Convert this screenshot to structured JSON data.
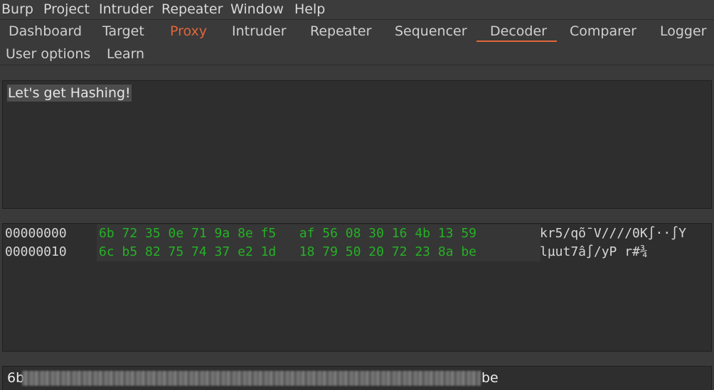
{
  "menu": [
    "Burp",
    "Project",
    "Intruder",
    "Repeater",
    "Window",
    "Help"
  ],
  "tabs": [
    "Dashboard",
    "Target",
    "Proxy",
    "Intruder",
    "Repeater",
    "Sequencer",
    "Decoder",
    "Comparer",
    "Logger",
    "User options",
    "Learn"
  ],
  "active_tab": "Decoder",
  "highlighted_tab": "Proxy",
  "colors": {
    "accent": "#e0663a",
    "hex_bytes": "#25b125",
    "background": "#3a3a3a",
    "panel": "#2e2e2e"
  },
  "input": {
    "text": "Let's get Hashing!"
  },
  "hex_view": {
    "rows": [
      {
        "offset": "00000000",
        "bytes": "6b 72 35 0e 71 9a 8e f5   af 56 08 30 16 4b 13 59",
        "ascii": "kr5∕qõ¯V∕∕∕∕0K∫··∫Y"
      },
      {
        "offset": "00000010",
        "bytes": "6c b5 82 75 74 37 e2 1d   18 79 50 20 72 23 8a be",
        "ascii": "lµut7â∫∕yP r#¾"
      }
    ]
  },
  "output": {
    "start": "6b",
    "end": "be"
  }
}
